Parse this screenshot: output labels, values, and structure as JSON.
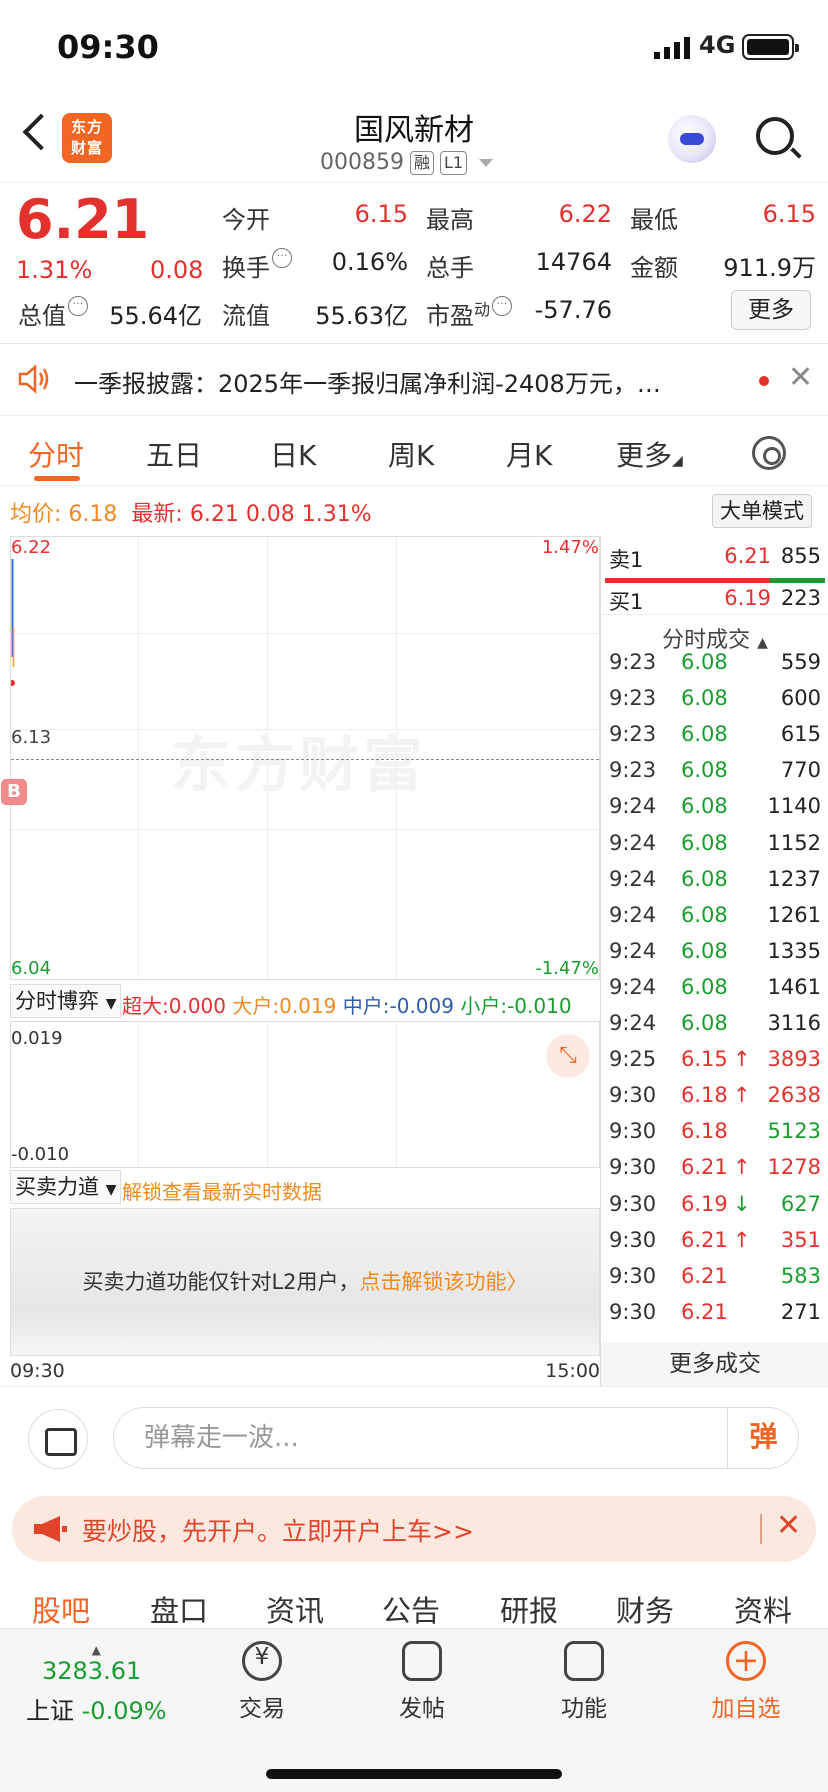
{
  "status_bar": {
    "time": "09:30",
    "network": "4G"
  },
  "header": {
    "logo_text": "东方财富",
    "stock_name": "国风新材",
    "stock_code": "000859",
    "tag_margin": "融",
    "tag_level": "L1"
  },
  "quote": {
    "price": "6.21",
    "change_pct": "1.31%",
    "change": "0.08",
    "today_open_label": "今开",
    "today_open": "6.15",
    "high_label": "最高",
    "high": "6.22",
    "low_label": "最低",
    "low": "6.15",
    "turnover_label": "换手",
    "turnover": "0.16%",
    "volume_label": "总手",
    "volume": "14764",
    "amount_label": "金额",
    "amount": "911.9万",
    "total_mv_label": "总值",
    "total_mv": "55.64亿",
    "float_mv_label": "流值",
    "float_mv": "55.63亿",
    "pe_label": "市盈",
    "pe_sup": "动",
    "pe": "-57.76",
    "more_label": "更多"
  },
  "notice": {
    "text": "一季报披露：2025年一季报归属净利润-2408万元，…"
  },
  "tabs": [
    "分时",
    "五日",
    "日K",
    "周K",
    "月K",
    "更多"
  ],
  "avg": {
    "avg_label": "均价:",
    "avg_value": "6.18",
    "latest_label": "最新:",
    "latest_value": "6.21",
    "latest_change": "0.08",
    "latest_pct": "1.31%",
    "big_order_label": "大单模式"
  },
  "chart": {
    "y_top": "6.22",
    "y_mid": "6.13",
    "y_bottom": "6.04",
    "pct_top": "1.47%",
    "pct_bottom": "-1.47%",
    "watermark": "东方财富",
    "b_marker": "B"
  },
  "game": {
    "dropdown_label": "分时博弈",
    "super_label": "超大:",
    "super_value": "0.000",
    "big_label": "大户:",
    "big_value": "0.019",
    "mid_label": "中户:",
    "mid_value": "-0.009",
    "small_label": "小户:",
    "small_value": "-0.010",
    "y_top": "0.019",
    "y_bottom": "-0.010"
  },
  "buysell": {
    "dropdown_label": "买卖力道",
    "unlock_text": "解锁查看最新实时数据",
    "lock_text": "买卖力道功能仅针对L2用户，",
    "lock_link": "点击解锁该功能"
  },
  "time_axis": {
    "start": "09:30",
    "end": "15:00"
  },
  "orderbook": {
    "sell1_label": "卖1",
    "sell1_price": "6.21",
    "sell1_vol": "855",
    "buy1_label": "买1",
    "buy1_price": "6.19",
    "buy1_vol": "223",
    "trades_title": "分时成交",
    "trades": [
      {
        "t": "9:23",
        "p": "6.08",
        "v": "559",
        "c": "green",
        "a": ""
      },
      {
        "t": "9:23",
        "p": "6.08",
        "v": "600",
        "c": "green",
        "a": ""
      },
      {
        "t": "9:23",
        "p": "6.08",
        "v": "615",
        "c": "green",
        "a": ""
      },
      {
        "t": "9:23",
        "p": "6.08",
        "v": "770",
        "c": "green",
        "a": ""
      },
      {
        "t": "9:24",
        "p": "6.08",
        "v": "1140",
        "c": "green",
        "a": ""
      },
      {
        "t": "9:24",
        "p": "6.08",
        "v": "1152",
        "c": "green",
        "a": ""
      },
      {
        "t": "9:24",
        "p": "6.08",
        "v": "1237",
        "c": "green",
        "a": ""
      },
      {
        "t": "9:24",
        "p": "6.08",
        "v": "1261",
        "c": "green",
        "a": ""
      },
      {
        "t": "9:24",
        "p": "6.08",
        "v": "1335",
        "c": "green",
        "a": ""
      },
      {
        "t": "9:24",
        "p": "6.08",
        "v": "1461",
        "c": "green",
        "a": ""
      },
      {
        "t": "9:24",
        "p": "6.08",
        "v": "3116",
        "c": "green",
        "a": ""
      },
      {
        "t": "9:25",
        "p": "6.15",
        "v": "3893",
        "c": "red",
        "a": "↑"
      },
      {
        "t": "9:30",
        "p": "6.18",
        "v": "2638",
        "c": "red",
        "a": "↑"
      },
      {
        "t": "9:30",
        "p": "6.18",
        "v": "5123",
        "c": "red",
        "a": "",
        "vc": "green"
      },
      {
        "t": "9:30",
        "p": "6.21",
        "v": "1278",
        "c": "red",
        "a": "↑"
      },
      {
        "t": "9:30",
        "p": "6.19",
        "v": "627",
        "c": "red",
        "a": "↓",
        "ac": "green",
        "vc": "green"
      },
      {
        "t": "9:30",
        "p": "6.21",
        "v": "351",
        "c": "red",
        "a": "↑"
      },
      {
        "t": "9:30",
        "p": "6.21",
        "v": "583",
        "c": "red",
        "a": "",
        "vc": "green"
      },
      {
        "t": "9:30",
        "p": "6.21",
        "v": "271",
        "c": "red",
        "a": ""
      }
    ],
    "more_trades": "更多成交"
  },
  "danmu": {
    "placeholder": "弹幕走一波...",
    "send": "弹"
  },
  "open_banner": {
    "text": "要炒股，先开户。立即开户上车>>"
  },
  "bottom_tabs": [
    "股吧",
    "盘口",
    "资讯",
    "公告",
    "研报",
    "财务",
    "资料"
  ],
  "nav": {
    "index_value": "3283.61",
    "index_name": "上证",
    "index_change": "-0.09%",
    "items": [
      "交易",
      "发帖",
      "功能",
      "加自选"
    ]
  },
  "colors": {
    "up": "#e3312e",
    "down": "#1a9d2f",
    "accent": "#f26522",
    "avg": "#f0a01f"
  }
}
